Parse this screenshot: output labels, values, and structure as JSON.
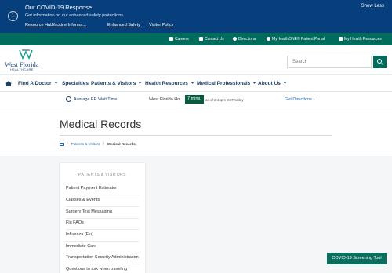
{
  "covid_banner": {
    "title": "Our COVID-19 Response",
    "subtitle": "Get information on our enhanced safety protections.",
    "links": [
      "Resource Hub",
      "Vaccine Informa...",
      "Enhanced Safety",
      "Visitor Policy"
    ],
    "show_less": "Show Less",
    "icon": "info-icon"
  },
  "utility_bar": {
    "items": [
      {
        "label": "Careers",
        "icon": "briefcase-icon"
      },
      {
        "label": "Contact Us",
        "icon": "phone-icon"
      },
      {
        "label": "Directions",
        "icon": "map-pin-icon"
      },
      {
        "label": "MyHealthONE® Patient Portal",
        "icon": "heart-icon"
      },
      {
        "label": "My Health Resources",
        "icon": "grid-icon"
      }
    ]
  },
  "header": {
    "logo_text": "West Florida",
    "logo_sub": "HEALTHCARE",
    "search_placeholder": "Search",
    "search_icon": "search-icon"
  },
  "nav": {
    "home_icon": "home-icon",
    "items": [
      {
        "label": "Find A Doctor",
        "dropdown": true
      },
      {
        "label": "Specialties",
        "dropdown": false
      },
      {
        "label": "Patients & Visitors",
        "dropdown": true
      },
      {
        "label": "Health Resources",
        "dropdown": true
      },
      {
        "label": "Medical Professionals",
        "dropdown": true
      },
      {
        "label": "About Us",
        "dropdown": true
      }
    ]
  },
  "er_bar": {
    "wait_label": "Average ER Wait Time",
    "hospital": "West Florida Ho...",
    "minutes": "7 mins.",
    "as_of": "as of 2:44pm CST today",
    "directions": "Get Directions ›"
  },
  "page": {
    "title": "Medical Records",
    "breadcrumb": {
      "sep": "/",
      "parent": "Patients & Visitors",
      "current": "Medical Records"
    }
  },
  "sidebar": {
    "title": "PATIENTS & VISITORS",
    "items": [
      "Patient Payment Estimator",
      "Classes & Events",
      "Surgery Text Messaging",
      "Flu FAQs",
      "Influenza (Flu)",
      "Immediate Care",
      "Transportation Security Administration",
      "Questions to ask when traveling"
    ]
  },
  "floating_button": "COVID-19 Screening Tool",
  "colors": {
    "banner_blue": "#063f7c",
    "utility_green": "#006c5c",
    "nav_navy": "#1e3f66",
    "link_blue": "#1e64a8",
    "er_badge_green": "#0a5a3e"
  }
}
